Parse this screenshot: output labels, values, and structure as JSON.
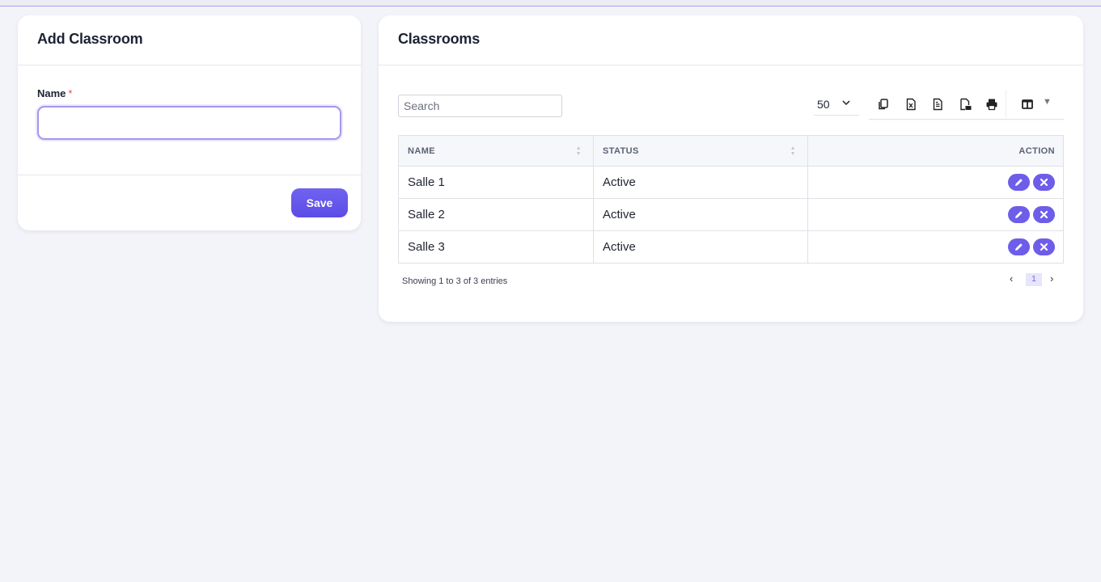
{
  "add_form": {
    "title": "Add Classroom",
    "name_label": "Name",
    "required_mark": "*",
    "name_value": "",
    "save_label": "Save"
  },
  "list": {
    "title": "Classrooms",
    "search_placeholder": "Search",
    "page_length": "50",
    "toolbar_icons": [
      "copy-icon",
      "excel-icon",
      "csv-icon",
      "pdf-icon",
      "print-icon",
      "columns-icon"
    ],
    "columns": [
      "NAME",
      "STATUS",
      "ACTION"
    ],
    "rows": [
      {
        "name": "Salle 1",
        "status": "Active"
      },
      {
        "name": "Salle 2",
        "status": "Active"
      },
      {
        "name": "Salle 3",
        "status": "Active"
      }
    ],
    "info": "Showing 1 to 3 of 3 entries",
    "pagination": {
      "prev": "‹",
      "current": "1",
      "next": "›"
    }
  },
  "colors": {
    "accent": "#6e5de9",
    "required": "#e5484d",
    "background": "#f3f4f9"
  }
}
